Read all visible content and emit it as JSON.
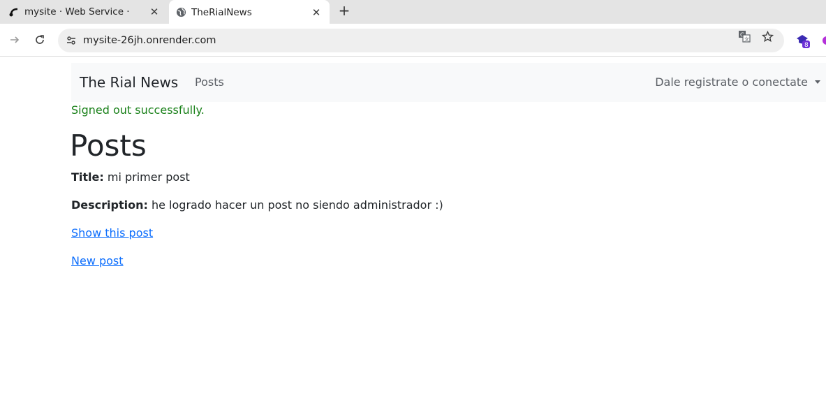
{
  "browser": {
    "tabs": [
      {
        "title": "mysite · Web Service ·",
        "favicon": "render-logo-icon"
      },
      {
        "title": "TheRialNews",
        "favicon": "globe-icon"
      }
    ],
    "url": "mysite-26jh.onrender.com",
    "extension_badge": "8"
  },
  "navbar": {
    "brand": "The Rial News",
    "posts_link": "Posts",
    "account_dropdown": "Dale registrate o conectate"
  },
  "notice": "Signed out successfully.",
  "heading": "Posts",
  "post": {
    "title_label": "Title:",
    "title_value": "mi primer post",
    "description_label": "Description:",
    "description_value": "he logrado hacer un post no siendo administrador :)",
    "show_link": "Show this post"
  },
  "new_post_link": "New post",
  "colors": {
    "notice_green": "#198019",
    "link_blue": "#0d6efd",
    "navbar_bg": "#f8f9fa"
  }
}
